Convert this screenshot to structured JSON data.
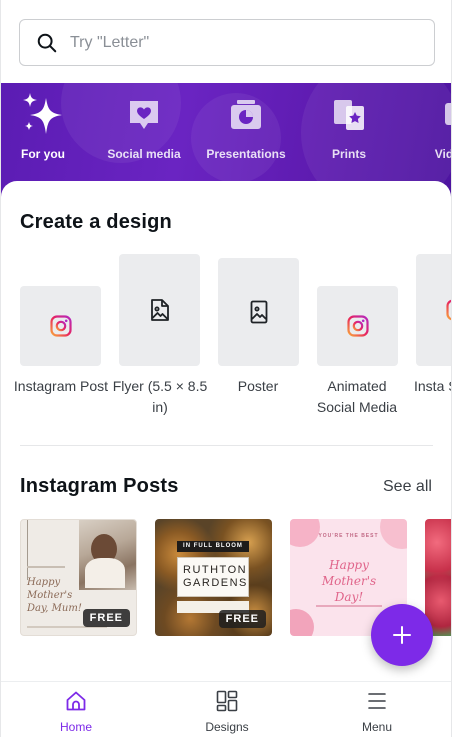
{
  "search": {
    "placeholder": "Try \"Letter\""
  },
  "categories": [
    {
      "label": "For you",
      "icon": "sparkle-icon",
      "active": true
    },
    {
      "label": "Social media",
      "icon": "heart-bubble-icon"
    },
    {
      "label": "Presentations",
      "icon": "presentation-icon"
    },
    {
      "label": "Prints",
      "icon": "prints-icon"
    },
    {
      "label": "Vid",
      "icon": "video-icon"
    }
  ],
  "create": {
    "title": "Create a design",
    "items": [
      {
        "label": "Instagram Post",
        "icon": "instagram-icon"
      },
      {
        "label": "Flyer (5.5 × 8.5 in)",
        "icon": "image-document-icon"
      },
      {
        "label": "Poster",
        "icon": "image-document-icon"
      },
      {
        "label": "Animated Social Media",
        "icon": "instagram-icon"
      },
      {
        "label": "Insta St",
        "icon": "instagram-icon"
      }
    ]
  },
  "instagram": {
    "title": "Instagram Posts",
    "see_all": "See all",
    "badge": "FREE",
    "templates": [
      {
        "text": "Happy Mother's Day, Mum!",
        "free": true
      },
      {
        "kicker": "IN FULL BLOOM",
        "title": "RUTHTON GARDENS",
        "free": true
      },
      {
        "kicker": "YOU'RE THE BEST",
        "title": "Happy Mother's Day!",
        "free": false
      }
    ]
  },
  "nav": [
    {
      "label": "Home",
      "icon": "home-icon",
      "active": true
    },
    {
      "label": "Designs",
      "icon": "designs-grid-icon"
    },
    {
      "label": "Menu",
      "icon": "menu-icon"
    }
  ],
  "colors": {
    "accent": "#7d2ae8",
    "band": "#5e1bb0",
    "tile": "#ebecee"
  }
}
